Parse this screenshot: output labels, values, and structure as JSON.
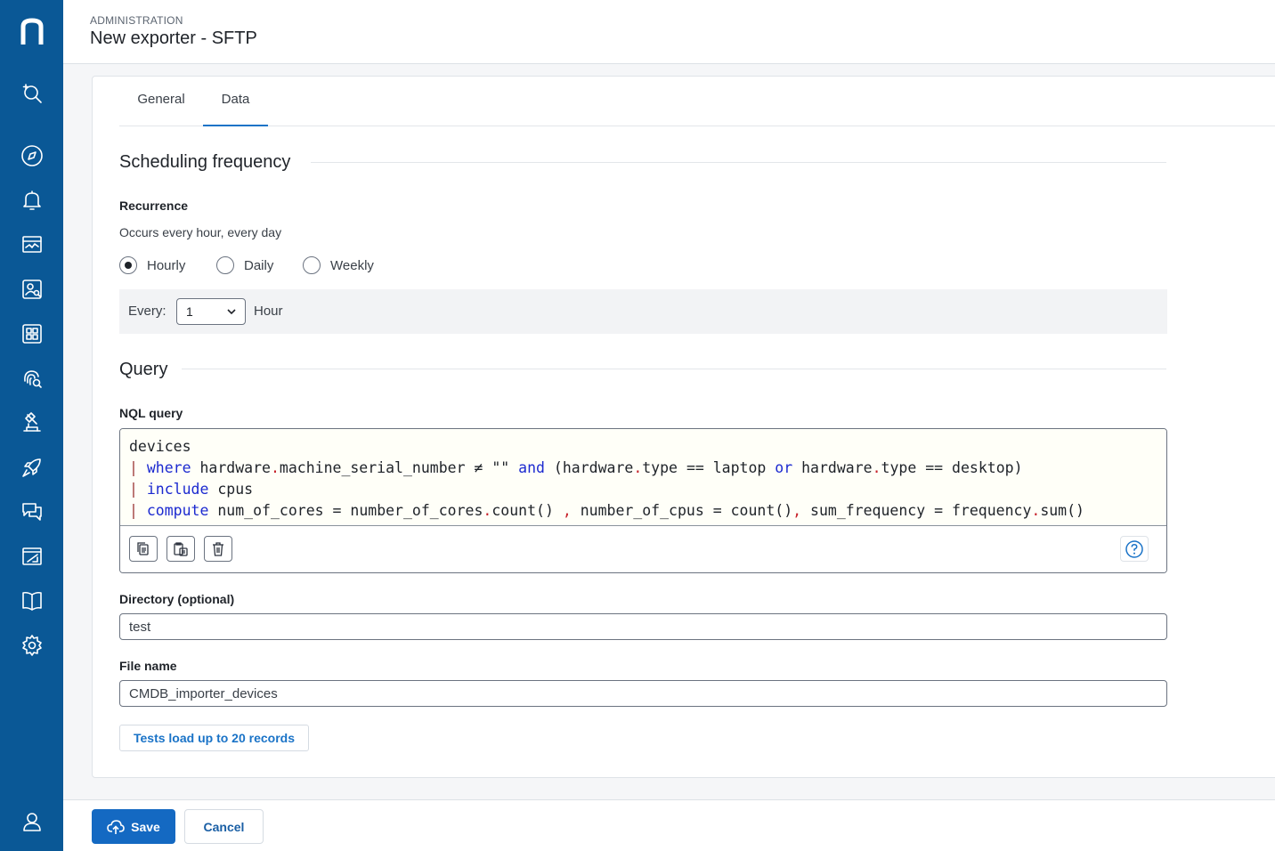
{
  "sidebar": {
    "logo": "n",
    "icons": [
      "search-sparkle-icon",
      "compass-icon",
      "bell-icon",
      "monitor-chart-icon",
      "user-search-icon",
      "dashboard-grid-icon",
      "fingerprint-search-icon",
      "investigation-icon",
      "rocket-icon",
      "chat-icon",
      "design-icon",
      "book-icon",
      "gear-icon",
      "user-icon"
    ]
  },
  "header": {
    "breadcrumb": "ADMINISTRATION",
    "title": "New exporter - SFTP"
  },
  "tabs": [
    {
      "label": "General",
      "active": false
    },
    {
      "label": "Data",
      "active": true
    }
  ],
  "scheduling": {
    "title": "Scheduling frequency",
    "recurrence_label": "Recurrence",
    "recurrence_text": "Occurs every hour, every day",
    "options": [
      "Hourly",
      "Daily",
      "Weekly"
    ],
    "selected": "Hourly",
    "every_label": "Every:",
    "every_value": "1",
    "every_unit": "Hour"
  },
  "query": {
    "title": "Query",
    "nql_label": "NQL query",
    "lines": [
      "devices",
      "| where hardware.machine_serial_number ≠ \"\" and (hardware.type == laptop or hardware.type == desktop)",
      "| include cpus",
      "| compute num_of_cores = number_of_cores.count() , number_of_cpus = count(), sum_frequency = frequency.sum()"
    ]
  },
  "directory": {
    "label": "Directory (optional)",
    "value": "test"
  },
  "file_name": {
    "label": "File name",
    "value": "CMDB_importer_devices"
  },
  "test_button": "Tests load up to 20 records",
  "footer": {
    "save_label": "Save",
    "cancel_label": "Cancel"
  },
  "colors": {
    "sidebar": "#0a5896",
    "primary": "#1469c2",
    "keyword": "#1c2ad0"
  }
}
